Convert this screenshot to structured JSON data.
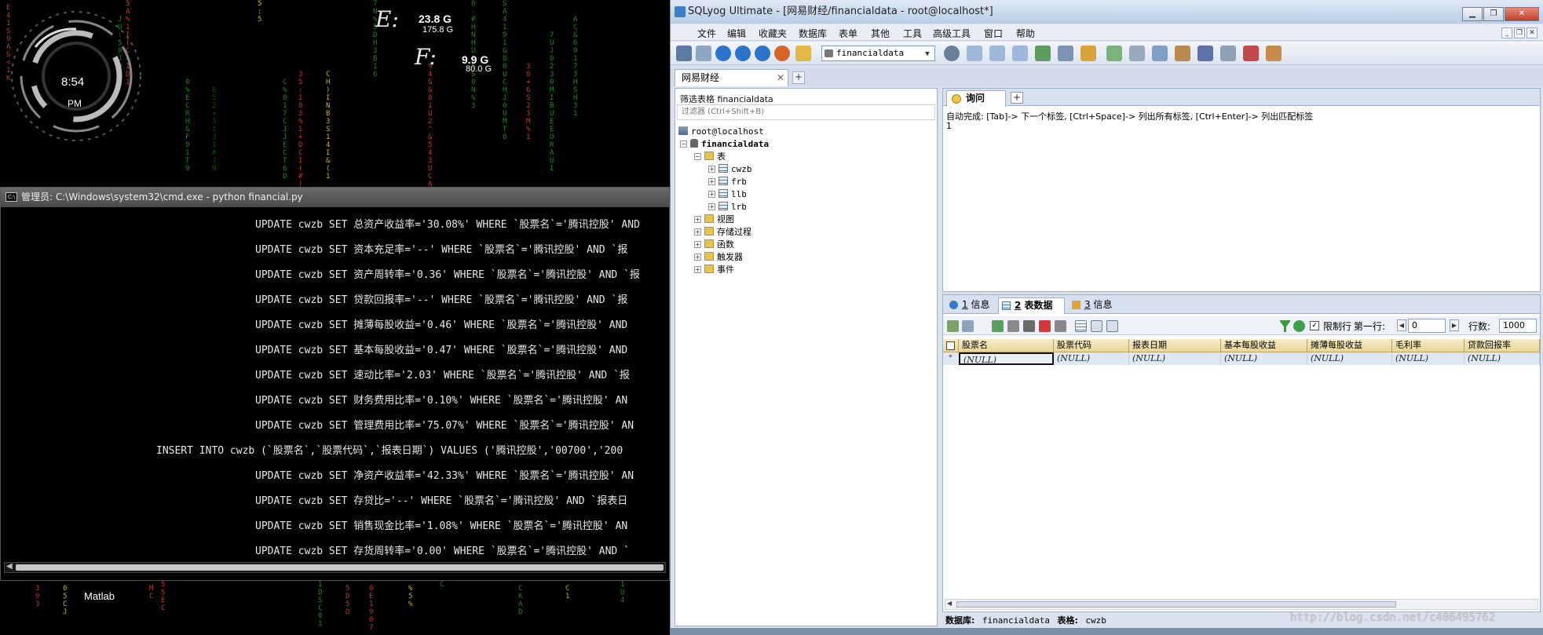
{
  "desktop": {
    "clock": {
      "time": "8:54",
      "ampm": "PM"
    },
    "drives": [
      {
        "letter": "E:",
        "used": "23.8 G",
        "total": "175.8 G"
      },
      {
        "letter": "F:",
        "used": "9.9 G",
        "total": "80.0 G"
      }
    ],
    "matlab_label": "Matlab",
    "watermark": "http://blog.csdn.net/c406495762"
  },
  "cmd": {
    "title": "管理员: C:\\Windows\\system32\\cmd.exe - python  financial.py",
    "lines": [
      "UPDATE cwzb SET 总资产收益率='30.08%' WHERE `股票名`='腾讯控股' AND",
      "UPDATE cwzb SET 资本充足率='--' WHERE `股票名`='腾讯控股' AND `报",
      "UPDATE cwzb SET 资产周转率='0.36' WHERE `股票名`='腾讯控股' AND `报",
      "UPDATE cwzb SET 贷款回报率='--' WHERE `股票名`='腾讯控股' AND `报",
      "UPDATE cwzb SET 摊薄每股收益='0.46' WHERE `股票名`='腾讯控股' AND",
      "UPDATE cwzb SET 基本每股收益='0.47' WHERE `股票名`='腾讯控股' AND",
      "UPDATE cwzb SET 速动比率='2.03' WHERE `股票名`='腾讯控股' AND `报",
      "UPDATE cwzb SET 财务费用比率='0.10%' WHERE `股票名`='腾讯控股' AN",
      "UPDATE cwzb SET 管理费用比率='75.07%' WHERE `股票名`='腾讯控股' AN",
      "INSERT INTO cwzb (`股票名`,`股票代码`,`报表日期`) VALUES ('腾讯控股','00700','200",
      "UPDATE cwzb SET 净资产收益率='42.33%' WHERE `股票名`='腾讯控股' AN",
      "UPDATE cwzb SET 存贷比='--' WHERE `股票名`='腾讯控股' AND `报表日",
      "UPDATE cwzb SET 销售现金比率='1.08%' WHERE `股票名`='腾讯控股' AN",
      "UPDATE cwzb SET 存货周转率='0.00' WHERE `股票名`='腾讯控股' AND `"
    ]
  },
  "sqlyog": {
    "title": "SQLyog Ultimate - [网易财经/financialdata - root@localhost*]",
    "menu": [
      "文件",
      "编辑",
      "收藏夹",
      "数据库",
      "表单",
      "其他",
      "工具",
      "高级工具",
      "窗口",
      "帮助"
    ],
    "db_selector": "financialdata",
    "connection_tab": "网易财经",
    "explorer": {
      "filter_label": "筛选表格 financialdata",
      "filter_placeholder": "过滤器 (Ctrl+Shift+B)",
      "server": "root@localhost",
      "database": "financialdata",
      "tables_folder": "表",
      "tables": [
        "cwzb",
        "frb",
        "llb",
        "lrb"
      ],
      "folders": [
        "视图",
        "存储过程",
        "函数",
        "触发器",
        "事件"
      ]
    },
    "query": {
      "tab_label": "询问",
      "autocomplete": "自动完成: [Tab]-> 下一个标签, [Ctrl+Space]-> 列出所有标签, [Ctrl+Enter]-> 列出匹配标签",
      "line_number": "1"
    },
    "result": {
      "tabs": [
        {
          "num": "1",
          "label": "信息"
        },
        {
          "num": "2",
          "label": "表数据"
        },
        {
          "num": "3",
          "label": "信息"
        }
      ],
      "limit_label": "限制行",
      "first_row_label": "第一行:",
      "first_row_value": "0",
      "rows_label": "行数:",
      "rows_value": "1000",
      "columns": [
        "股票名",
        "股票代码",
        "报表日期",
        "基本每股收益",
        "摊薄每股收益",
        "毛利率",
        "贷款回报率"
      ],
      "null_value": "(NULL)",
      "row_marker": "*"
    },
    "status": {
      "db_label": "数据库:",
      "db_value": "financialdata",
      "table_label": "表格:",
      "table_value": "cwzb"
    }
  }
}
